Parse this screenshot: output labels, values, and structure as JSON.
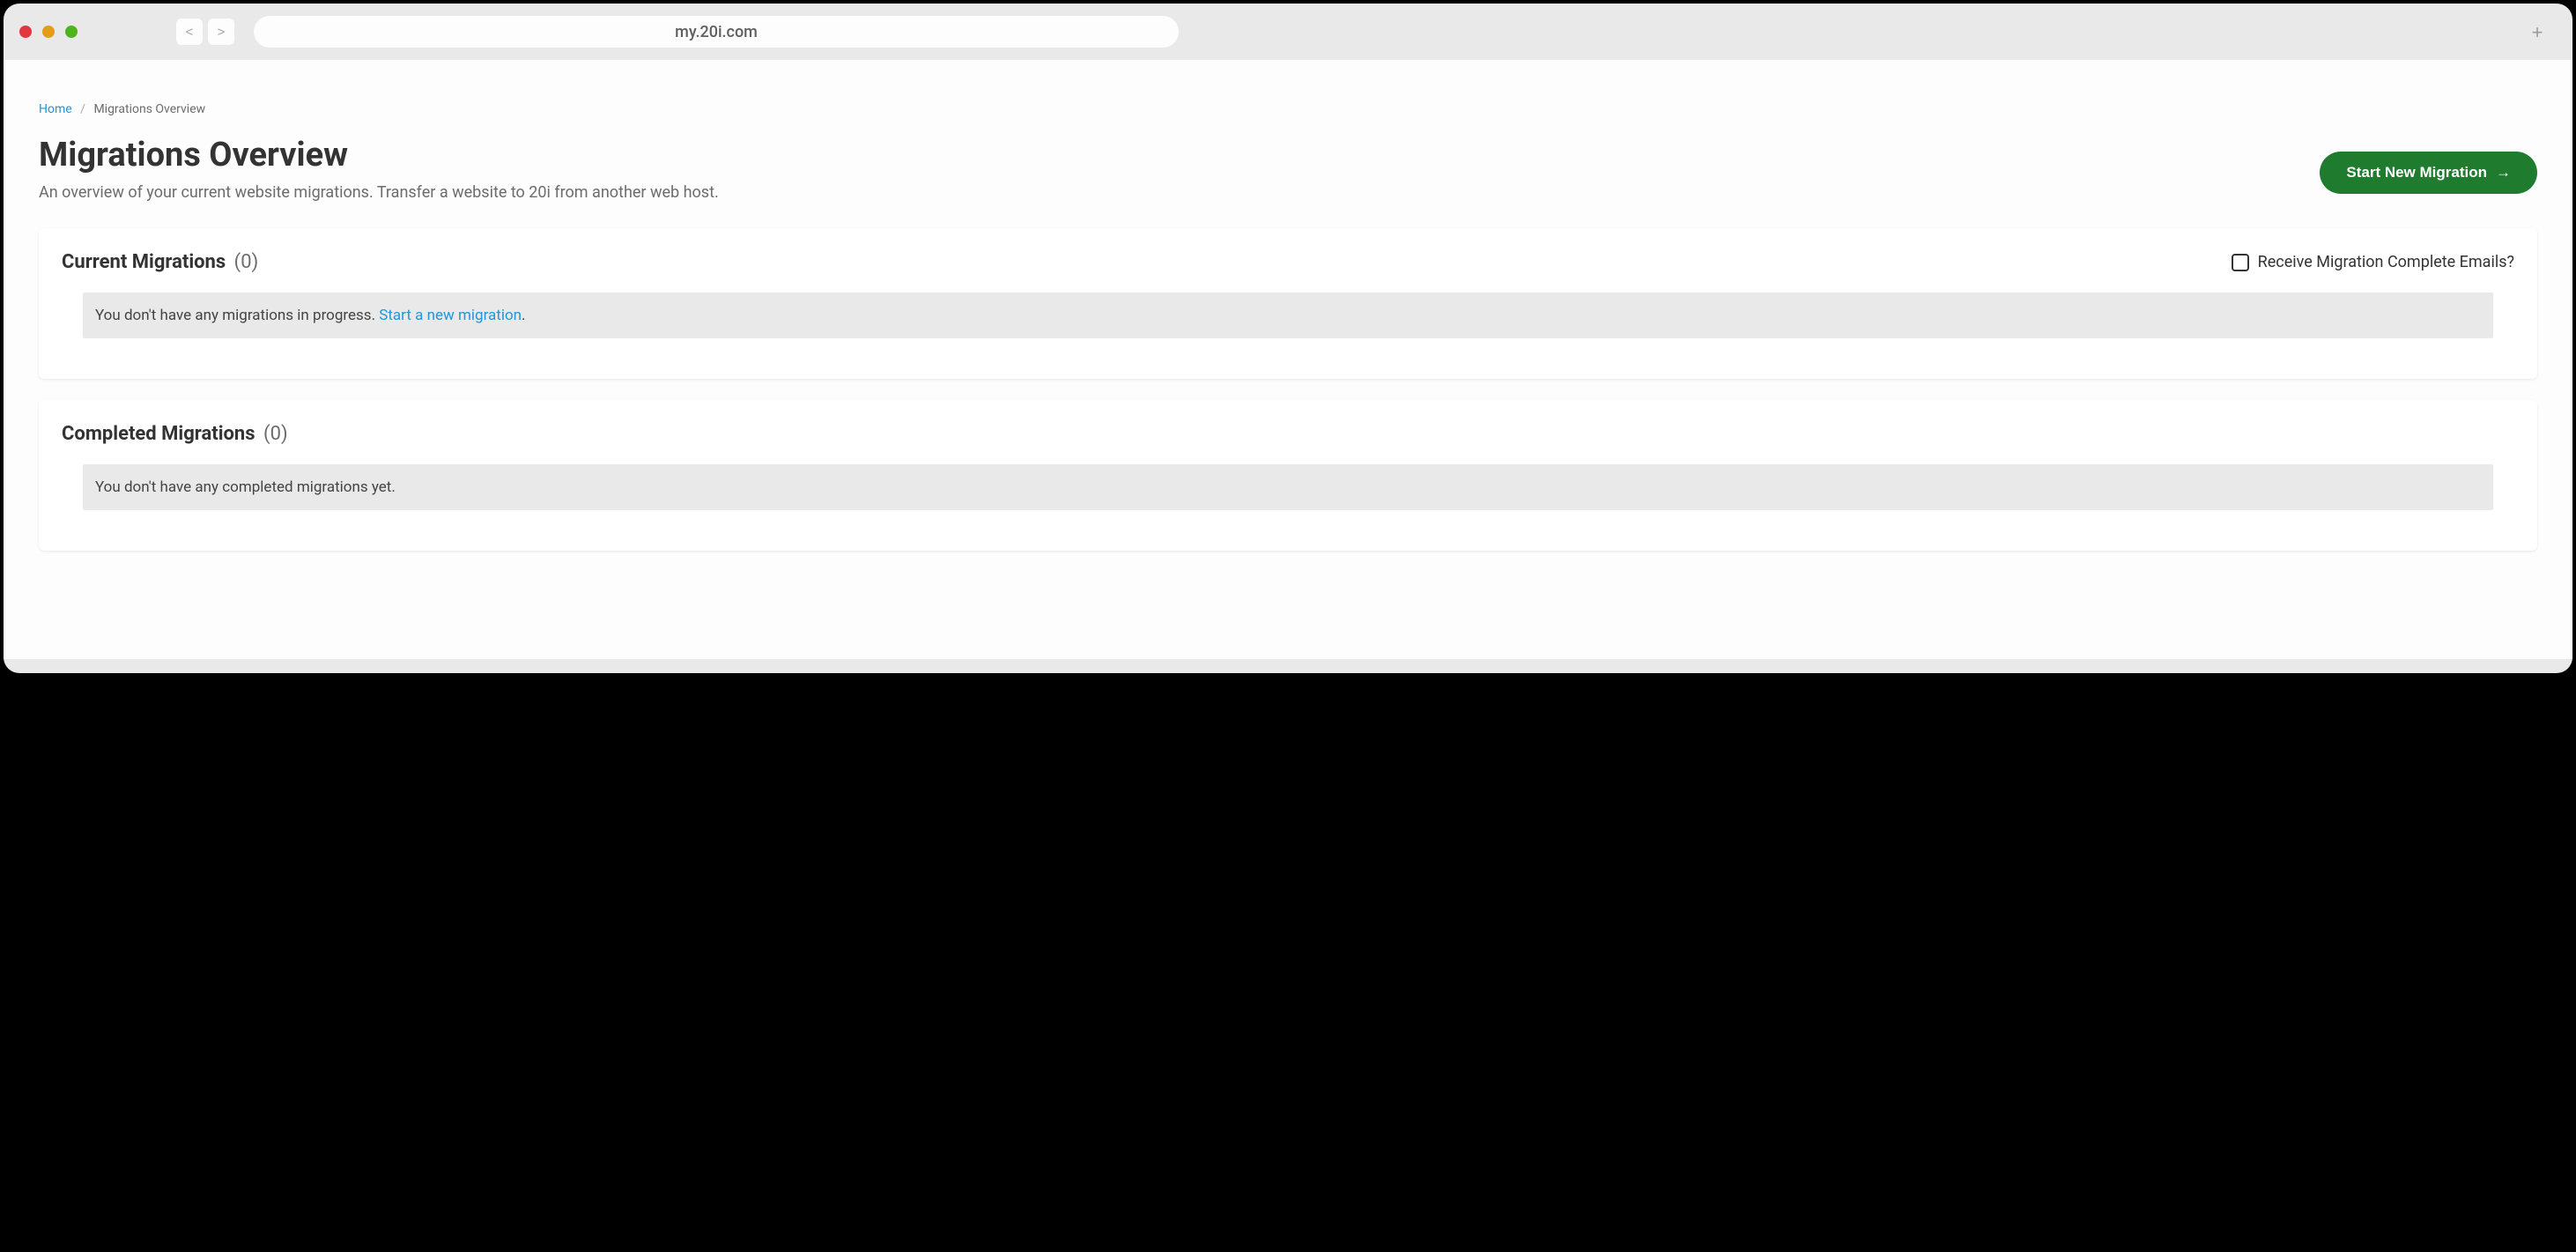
{
  "browser": {
    "url": "my.20i.com",
    "back_label": "<",
    "forward_label": ">",
    "new_tab_label": "+"
  },
  "breadcrumb": {
    "home": "Home",
    "separator": "/",
    "current": "Migrations Overview"
  },
  "header": {
    "title": "Migrations Overview",
    "subtitle": "An overview of your current website migrations. Transfer a website to 20i from another web host.",
    "start_button": "Start New Migration",
    "arrow": "→"
  },
  "current_panel": {
    "title": "Current Migrations",
    "count": "(0)",
    "checkbox_label": "Receive Migration Complete Emails?",
    "empty_prefix": "You don't have any migrations in progress. ",
    "empty_link": "Start a new migration",
    "empty_suffix": "."
  },
  "completed_panel": {
    "title": "Completed Migrations",
    "count": "(0)",
    "empty": "You don't have any completed migrations yet."
  }
}
